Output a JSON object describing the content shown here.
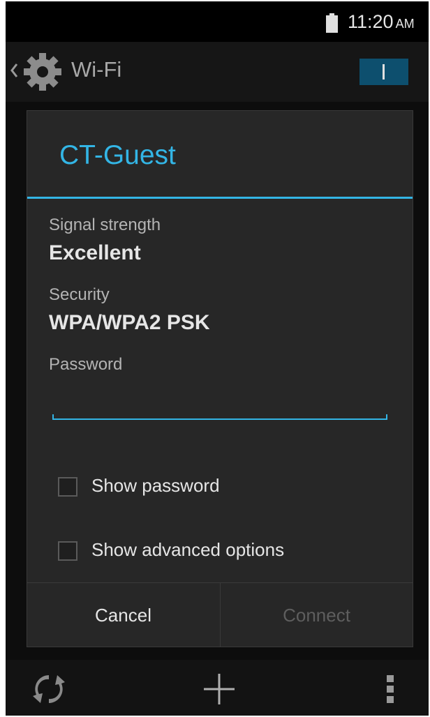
{
  "status_bar": {
    "time": "11:20",
    "ampm": "AM",
    "battery_icon": "battery-full-icon"
  },
  "action_bar": {
    "title": "Wi-Fi",
    "up_icon": "chevron-left-icon",
    "app_icon": "settings-gear-icon",
    "toggle_state": "on",
    "toggle_color": "#0d4f6e"
  },
  "dialog": {
    "title": "CT-Guest",
    "accent_color": "#33b5e5",
    "signal_label": "Signal strength",
    "signal_value": "Excellent",
    "security_label": "Security",
    "security_value": "WPA/WPA2 PSK",
    "password_label": "Password",
    "password_value": "",
    "show_password_label": "Show password",
    "show_password_checked": false,
    "show_advanced_label": "Show advanced options",
    "show_advanced_checked": false,
    "cancel_label": "Cancel",
    "connect_label": "Connect",
    "connect_enabled": false
  },
  "bottom_bar": {
    "left_icon": "wps-icon",
    "center_icon": "add-icon",
    "right_icon": "overflow-menu-icon"
  }
}
